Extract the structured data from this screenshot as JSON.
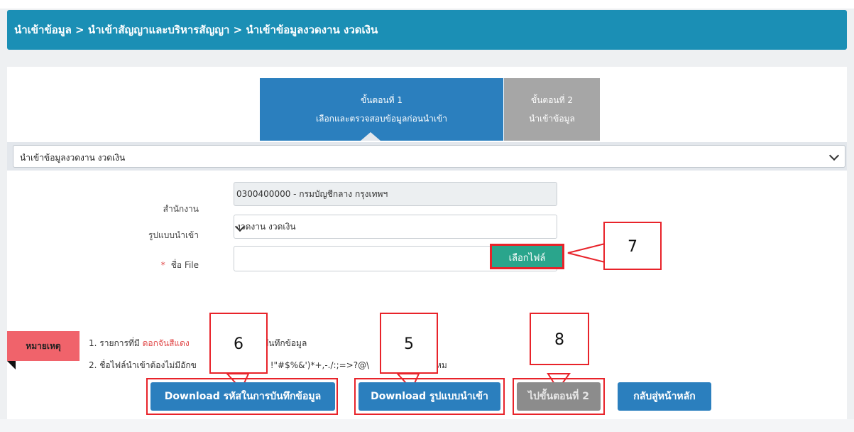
{
  "breadcrumb": "นำเข้าข้อมูล > นำเข้าสัญญาและบริหารสัญญา > นำเข้าข้อมูลงวดงาน งวดเงิน",
  "steps": [
    {
      "title": "ขั้นตอนที่ 1",
      "subtitle": "เลือกและตรวจสอบข้อมูลก่อนนำเข้า",
      "active": true
    },
    {
      "title": "ขั้นตอนที่ 2",
      "subtitle": "นำเข้าข้อมูล",
      "active": false
    }
  ],
  "import_type_select": {
    "value": "นำเข้าข้อมูลงวดงาน งวดเงิน"
  },
  "form": {
    "office_label": "สำนักงาน",
    "office_value": "0300400000 - กรมบัญชีกลาง กรุงเทพฯ",
    "format_label": "รูปแบบนำเข้า",
    "format_value": "งวดงาน งวดเงิน",
    "file_required_mark": "*",
    "file_label": "ชื่อ File",
    "file_value": "",
    "choose_file_button": "เลือกไฟล์"
  },
  "notes": {
    "tag": "หมายเหตุ",
    "line1_prefix": "1. รายการที่มี",
    "line1_red": "ดอกจันสีแดง",
    "line1_suffix": "บันทึกข้อมูล",
    "line2_prefix": "2. ชื่อไฟล์นำเข้าต้องไม่มีอักข",
    "line2_chars": "!\"#$%&')*+,-./:;=>?@\\",
    "line2_suffix": "หม"
  },
  "buttons": {
    "download_codes": "Download รหัสในการบันทึกข้อมูล",
    "download_format": "Download รูปแบบนำเข้า",
    "next_step": "ไปขั้นตอนที่ 2",
    "back_home": "กลับสู่หน้าหลัก"
  },
  "callouts": {
    "c7": "7",
    "c6": "6",
    "c5": "5",
    "c8": "8"
  },
  "colors": {
    "header": "#1b8fb5",
    "step_active": "#2b7fbe",
    "step_inactive": "#a6a6a6",
    "file_button": "#2aa58c",
    "primary_button": "#2b7fbe",
    "disabled_button": "#8c8c8c",
    "annotation": "#e8232a",
    "note_tag": "#f0636b"
  }
}
